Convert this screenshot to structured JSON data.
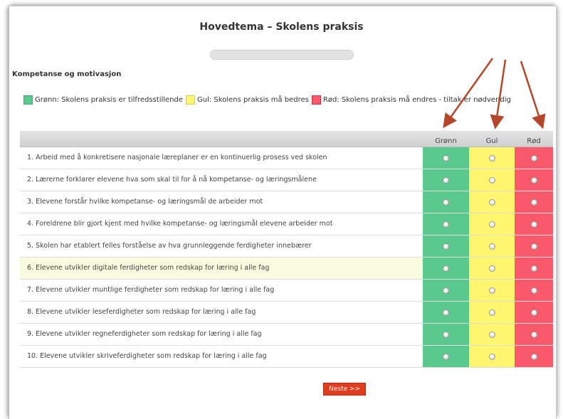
{
  "page": {
    "title": "Hovedtema – Skolens praksis",
    "section_title": "Kompetanse og motivasjon"
  },
  "legend": {
    "green": "Grønn: Skolens praksis er tilfredsstillende",
    "yellow": "Gul: Skolens praksis må bedres",
    "red": "Rød: Skolens praksis må endres - tiltak er nødvendig"
  },
  "table": {
    "columns": [
      "Grønn",
      "Gul",
      "Rød"
    ],
    "questions": [
      "1. Arbeid med å konkretisere nasjonale læreplaner er en kontinuerlig prosess ved skolen",
      "2. Lærerne forklarer elevene hva som skal til for å nå kompetanse- og læringsmålene",
      "3. Elevene forstår hvilke kompetanse- og læringsmål de arbeider mot",
      "4. Foreldrene blir gjort kjent med hvilke kompetanse- og læringsmål elevene arbeider mot",
      "5. Skolen har etablert felles forståelse av hva grunnleggende ferdigheter innebærer",
      "6. Elevene utvikler digitale ferdigheter som redskap for læring i alle fag",
      "7. Elevene utvikler muntlige ferdigheter som redskap for læring i alle fag",
      "8. Elevene utvikler leseferdigheter som redskap for læring i alle fag",
      "9. Elevene utvikler regneferdigheter som redskap for læring i alle fag",
      "10. Elevene utvikler skriveferdigheter som redskap for læring i alle fag"
    ]
  },
  "buttons": {
    "next": "Neste >>"
  },
  "colors": {
    "green": "#59c98e",
    "yellow": "#fff56f",
    "red": "#f9596a",
    "arrow": "#b5462a",
    "next_button": "#e23c1f"
  }
}
